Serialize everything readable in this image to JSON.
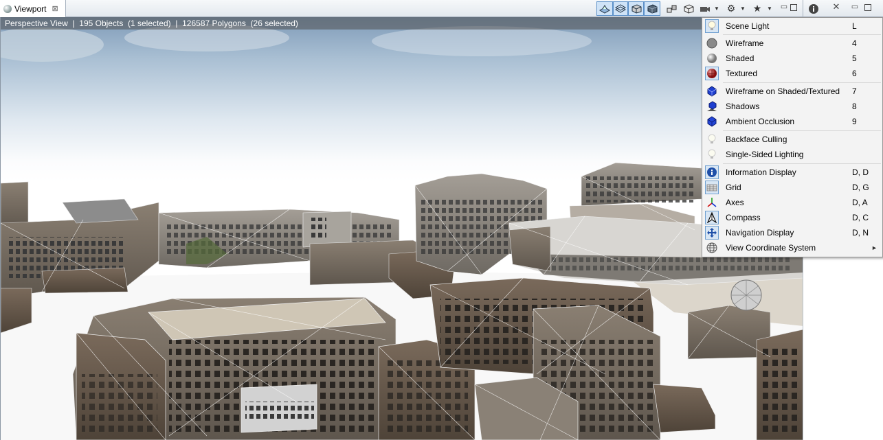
{
  "window": {
    "tab_title": "Viewport",
    "tab_close": "⊠"
  },
  "status_bar": {
    "text": "Perspective View  |  195 Objects  (1 selected)  |  126587 Polygons  (26 selected)"
  },
  "menu": {
    "items": [
      {
        "label": "Scene Light",
        "shortcut": "L",
        "icon": "bulb-icon"
      },
      {
        "label": "Wireframe",
        "shortcut": "4",
        "icon": "gray-sphere-icon"
      },
      {
        "label": "Shaded",
        "shortcut": "5",
        "icon": "shaded-sphere-icon"
      },
      {
        "label": "Textured",
        "shortcut": "6",
        "icon": "textured-sphere-icon"
      },
      {
        "label": "Wireframe on Shaded/Textured",
        "shortcut": "7",
        "icon": "blue-cube-icon"
      },
      {
        "label": "Shadows",
        "shortcut": "8",
        "icon": "shadow-cube-icon"
      },
      {
        "label": "Ambient Occlusion",
        "shortcut": "9",
        "icon": "ao-cube-icon"
      },
      {
        "label": "Backface Culling",
        "shortcut": "",
        "icon": "bulb-icon"
      },
      {
        "label": "Single-Sided Lighting",
        "shortcut": "",
        "icon": "bulb-icon"
      },
      {
        "label": "Information Display",
        "shortcut": "D, D",
        "icon": "info-icon"
      },
      {
        "label": "Grid",
        "shortcut": "D, G",
        "icon": "grid-icon"
      },
      {
        "label": "Axes",
        "shortcut": "D, A",
        "icon": "axes-icon"
      },
      {
        "label": "Compass",
        "shortcut": "D, C",
        "icon": "compass-icon"
      },
      {
        "label": "Navigation Display",
        "shortcut": "D, N",
        "icon": "navigation-icon"
      },
      {
        "label": "View Coordinate System",
        "shortcut": "",
        "icon": "globe-icon"
      }
    ],
    "submenu_arrow": "►"
  },
  "colors": {
    "accent": "#5a8fc8",
    "selected_bg": "#d8e6f4",
    "menu_bg": "#f3f3f3"
  }
}
